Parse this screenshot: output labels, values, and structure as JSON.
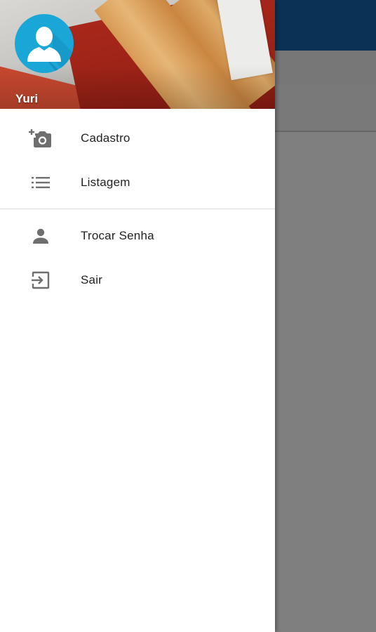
{
  "colors": {
    "app_bar": "#1565a8",
    "avatar": "#1aa7d8",
    "icon": "#6f6f6f",
    "text": "#222222"
  },
  "drawer": {
    "header": {
      "user_name": "Yuri",
      "avatar_icon": "person-silhouette-icon"
    },
    "menu_primary": [
      {
        "label": "Cadastro",
        "icon": "add-a-photo-icon"
      },
      {
        "label": "Listagem",
        "icon": "list-icon"
      }
    ],
    "menu_secondary": [
      {
        "label": "Trocar Senha",
        "icon": "person-icon"
      },
      {
        "label": "Sair",
        "icon": "exit-icon"
      }
    ]
  }
}
